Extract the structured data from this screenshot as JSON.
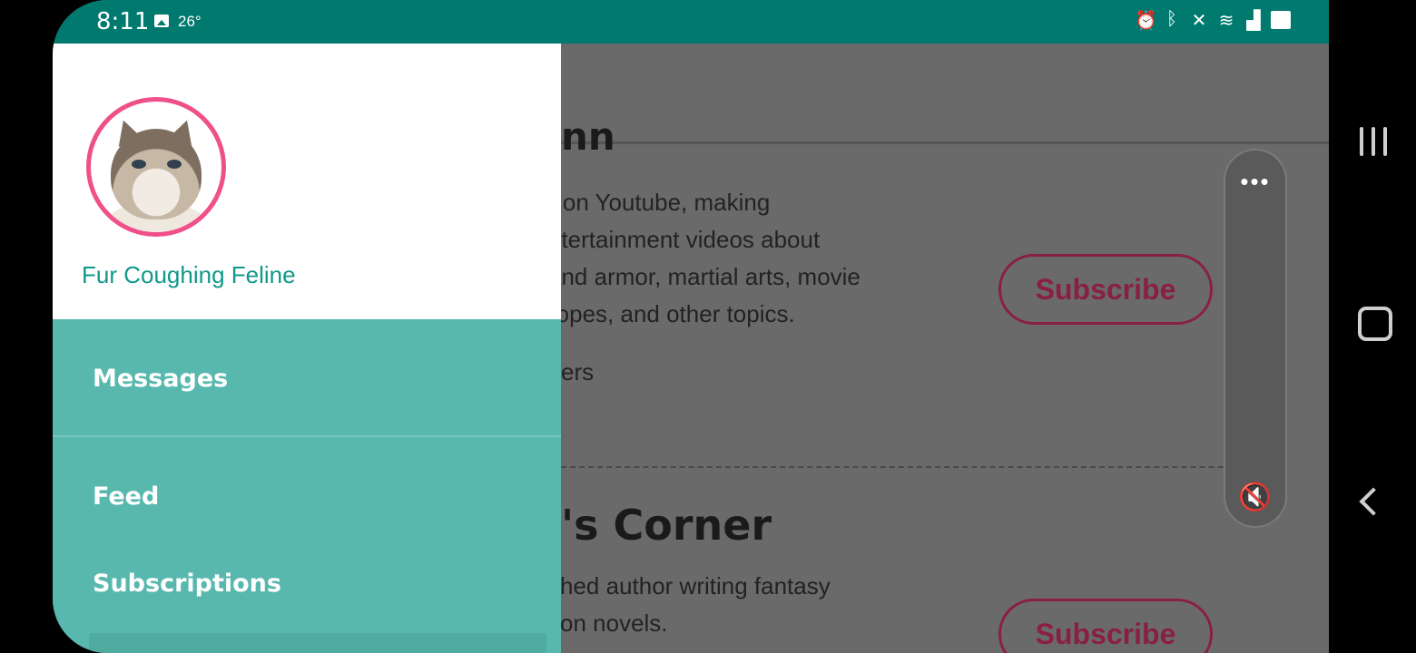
{
  "status_bar": {
    "time": "8:11",
    "temperature": "26°",
    "icons": [
      "alarm-icon",
      "bluetooth-icon",
      "mute-icon",
      "wifi-icon",
      "signal-icon",
      "battery-icon"
    ]
  },
  "background": {
    "card1": {
      "title_fragment": "nn",
      "description_lines": [
        "r on Youtube, making",
        "ntertainment videos about",
        "and armor, martial arts, movie",
        "ropes, and other topics."
      ],
      "meta": "ers",
      "subscribe_label": "Subscribe"
    },
    "card2": {
      "title_fragment": "'s Corner",
      "description_lines": [
        "shed author writing fantasy",
        "tion novels."
      ],
      "subscribe_label": "Subscribe"
    }
  },
  "volume_panel": {
    "more_glyph": "•••",
    "mute_glyph": "🔇"
  },
  "drawer": {
    "user_name": "Fur Coughing Feline",
    "items": [
      {
        "label": "Messages"
      },
      {
        "label": "Feed"
      },
      {
        "label": "Subscriptions"
      }
    ]
  },
  "colors": {
    "status_bar": "#00796f",
    "drawer": "#58b8ae",
    "accent_pink": "#f0508a",
    "subscribe": "#8a1f44"
  }
}
